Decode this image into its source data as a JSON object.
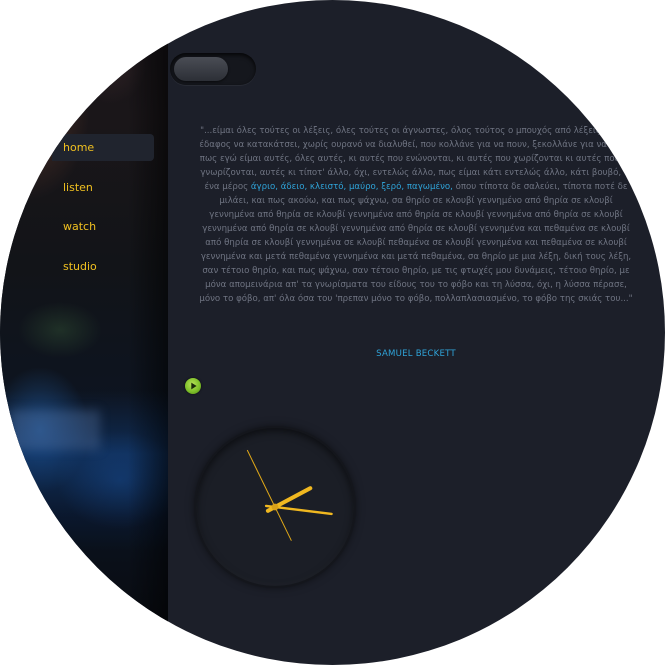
{
  "nav": {
    "items": [
      {
        "label": "home",
        "active": true
      },
      {
        "label": "listen",
        "active": false
      },
      {
        "label": "watch",
        "active": false
      },
      {
        "label": "studio",
        "active": false
      }
    ]
  },
  "toggle": {
    "state": "off"
  },
  "quote": {
    "text_before": "\"...είμαι όλες τούτες οι λέξεις, όλες τούτες οι άγνωστες, όλος τούτος ο μπουχός από λέξεις, χωρίς έδαφος να κατακάτσει, χωρίς ουρανό να διαλυθεί, που κολλάνε για να πουν, ξεκολλάνε για να πουν, πως εγώ είμαι αυτές, όλες αυτές, κι αυτές που ενώνονται, κι αυτές που χωρίζονται κι αυτές που δε γνωρίζονται, αυτές κι τίποτ' άλλο, όχι, εντελώς άλλο, πως είμαι κάτι εντελώς άλλο, κάτι βουβό, σ' ένα μέρος ",
    "highlight": "άγριο, άδειο, κλειστό, μαύρο, ξερό, παγωμένο,",
    "text_after": " όπου τίποτα δε σαλεύει, τίποτα ποτέ δε μιλάει, και πως ακούω, και πως ψάχνω, σα θηρίο σε κλουβί γεννημένο από θηρία σε κλουβί γεννημένα από θηρία σε κλουβί γεννημένα από θηρία σε κλουβί γεννημένα από θηρία σε κλουβί γεννημένα από θηρία σε κλουβί γεννημένα από θηρία σε κλουβί γεννημένα και πεθαμένα σε κλουβί από θηρία σε κλουβί γεννημένα σε κλουβί πεθαμένα σε κλουβί γεννημένα και πεθαμένα σε κλουβί γεννημένα και μετά πεθαμένα γεννημένα και μετά πεθαμένα, σα θηρίο με μια λέξη, δική τους λέξη, σαν τέτοιο θηρίο, και πως ψάχνω, σαν τέτοιο θηρίο, με τις φτωχές μου δυνάμεις, τέτοιο θηρίο, με μόνα απομεινάρια απ' τα γνωρίσματα του είδους του το φόβο και τη λύσσα, όχι, η λύσσα πέρασε, μόνο το φόβο, απ' όλα όσα του 'πρεπαν μόνο το φόβο, πολλαπλασιασμένο, το φόβο της σκιάς του...\"",
    "author": "SAMUEL BECKETT"
  },
  "player": {
    "icon": "play-icon"
  },
  "clock": {
    "hour_hand_deg": 62,
    "minute_hand_deg": 97,
    "second_hand_deg": 334
  },
  "colors": {
    "background": "#1c1f29",
    "nav_text": "#f0c020",
    "quote_text": "#6f7482",
    "accent_blue": "#2fa3d8",
    "clock_hands": "#f0b820",
    "play_green": "#7fc02a"
  }
}
